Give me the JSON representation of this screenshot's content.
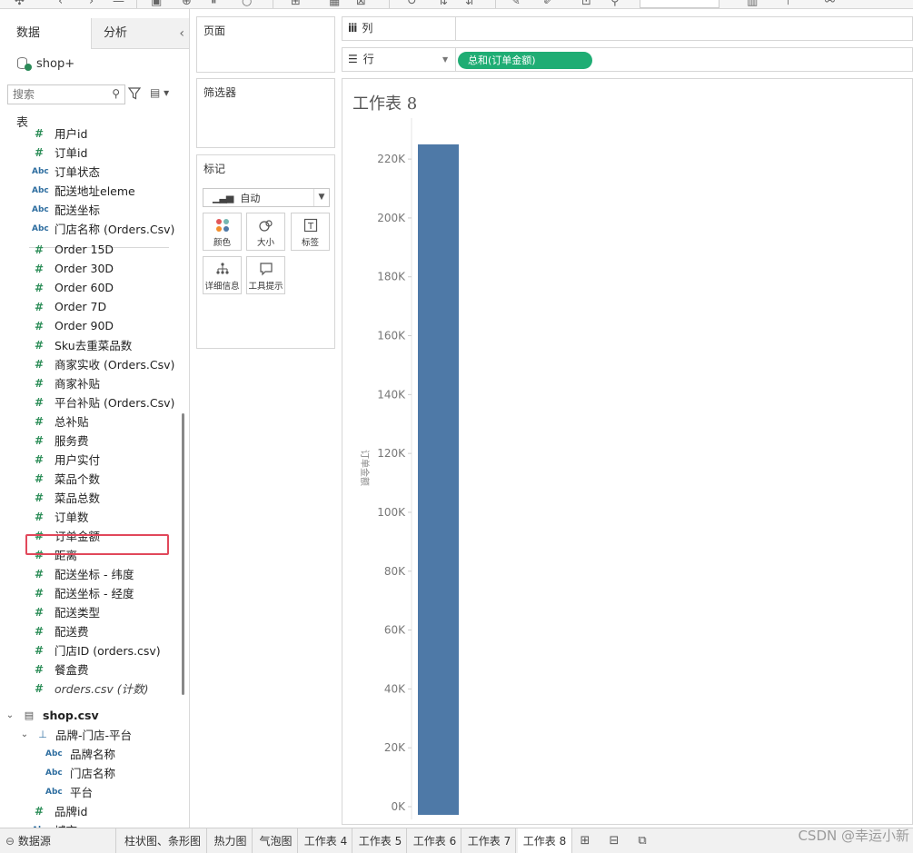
{
  "data_pane": {
    "tabs": [
      "数据",
      "分析"
    ],
    "datasource": "shop+",
    "search_placeholder": "搜索",
    "tables_label": "表",
    "fields_a": [
      {
        "type": "num",
        "name": "用户id"
      },
      {
        "type": "num",
        "name": "订单id"
      },
      {
        "type": "abc",
        "name": "订单状态"
      },
      {
        "type": "abc",
        "name": "配送地址eleme"
      },
      {
        "type": "abc",
        "name": "配送坐标"
      },
      {
        "type": "abc",
        "name": "门店名称 (Orders.Csv)"
      }
    ],
    "fields_b": [
      {
        "type": "num",
        "name": "Order 15D"
      },
      {
        "type": "num",
        "name": "Order 30D"
      },
      {
        "type": "num",
        "name": "Order 60D"
      },
      {
        "type": "num",
        "name": "Order 7D"
      },
      {
        "type": "num",
        "name": "Order 90D"
      },
      {
        "type": "num",
        "name": "Sku去重菜品数"
      },
      {
        "type": "num",
        "name": "商家实收 (Orders.Csv)"
      },
      {
        "type": "num",
        "name": "商家补贴"
      },
      {
        "type": "num",
        "name": "平台补贴 (Orders.Csv)"
      },
      {
        "type": "num",
        "name": "总补贴"
      },
      {
        "type": "num",
        "name": "服务费"
      },
      {
        "type": "num",
        "name": "用户实付"
      },
      {
        "type": "num",
        "name": "菜品个数"
      },
      {
        "type": "num",
        "name": "菜品总数"
      },
      {
        "type": "num",
        "name": "订单数"
      },
      {
        "type": "num",
        "name": "订单金额"
      },
      {
        "type": "num",
        "name": "距离"
      },
      {
        "type": "num",
        "name": "配送坐标 - 纬度"
      },
      {
        "type": "num",
        "name": "配送坐标 - 经度"
      },
      {
        "type": "num",
        "name": "配送类型"
      },
      {
        "type": "num",
        "name": "配送费"
      },
      {
        "type": "num",
        "name": "门店ID (orders.csv)"
      },
      {
        "type": "num",
        "name": "餐盒费"
      },
      {
        "type": "num",
        "name": "orders.csv (计数)"
      }
    ],
    "table2": "shop.csv",
    "hierarchy": "品牌-门店-平台",
    "hierarchy_fields": [
      "品牌名称",
      "门店名称",
      "平台"
    ],
    "table2_field": "品牌id",
    "cut_field": "城市"
  },
  "cards": {
    "pages": "页面",
    "filters": "筛选器",
    "marks": "标记",
    "mark_type": "自动",
    "mark_buttons": [
      "颜色",
      "大小",
      "标签",
      "详细信息",
      "工具提示"
    ]
  },
  "shelves": {
    "columns_label": "列",
    "rows_label": "行",
    "rows_pill": "总和(订单金额)"
  },
  "sheet": {
    "title": "工作表 8"
  },
  "chart_data": {
    "type": "bar",
    "categories": [
      ""
    ],
    "values": [
      225000
    ],
    "ylabel": "订单金额",
    "ylim": [
      0,
      233000
    ],
    "yticks": [
      "0K",
      "20K",
      "40K",
      "60K",
      "80K",
      "100K",
      "120K",
      "140K",
      "160K",
      "180K",
      "200K",
      "220K"
    ],
    "bar_color": "#4e79a7"
  },
  "bottom_tabs": {
    "datasource": "数据源",
    "sheets": [
      "柱状图、条形图",
      "热力图",
      "气泡图",
      "工作表 4",
      "工作表 5",
      "工作表 6",
      "工作表 7",
      "工作表 8"
    ]
  },
  "watermark": "CSDN @幸运小新",
  "colors": {
    "accent_green": "#1fad74",
    "highlight_red": "#e1485b",
    "num_field": "#2f8f5a",
    "abc_field": "#2e6ea0"
  }
}
